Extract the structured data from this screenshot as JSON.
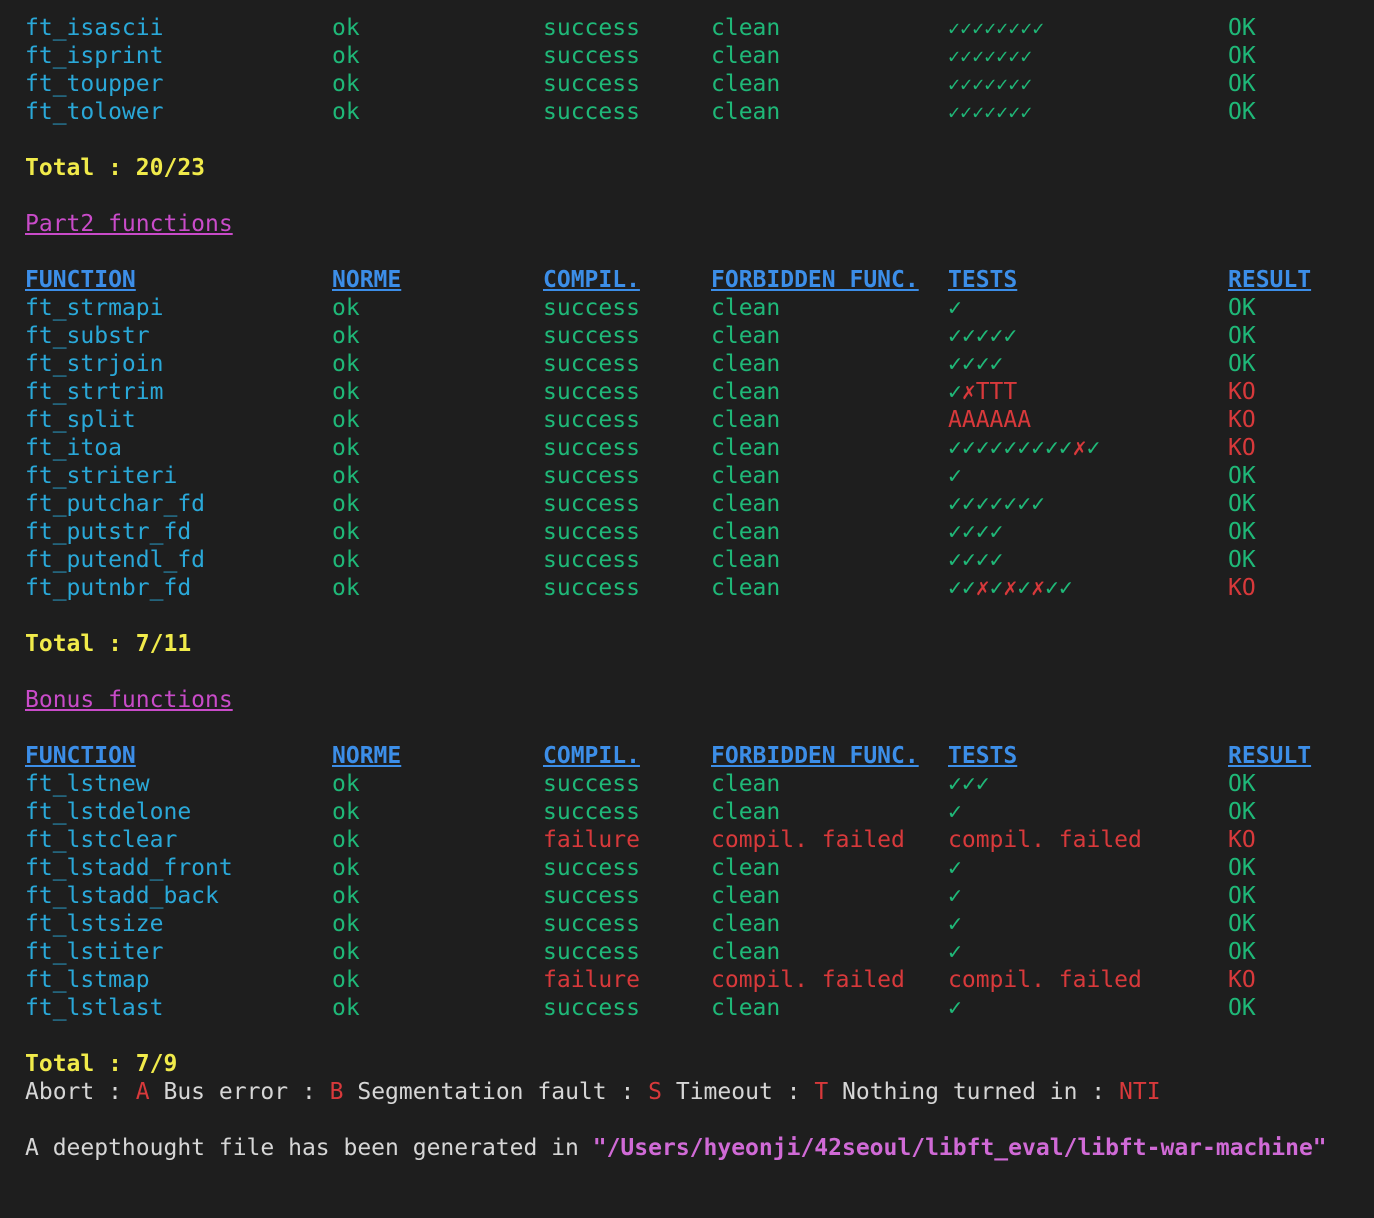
{
  "part1_tail": {
    "rows": [
      {
        "fn": "ft_isascii",
        "norme": "ok",
        "compil": "success",
        "forbidden": "clean",
        "tests": [
          {
            "t": "✓✓✓✓✓✓✓✓",
            "s": "ok"
          }
        ],
        "result": "OK"
      },
      {
        "fn": "ft_isprint",
        "norme": "ok",
        "compil": "success",
        "forbidden": "clean",
        "tests": [
          {
            "t": "✓✓✓✓✓✓✓",
            "s": "ok"
          }
        ],
        "result": "OK"
      },
      {
        "fn": "ft_toupper",
        "norme": "ok",
        "compil": "success",
        "forbidden": "clean",
        "tests": [
          {
            "t": "✓✓✓✓✓✓✓",
            "s": "ok"
          }
        ],
        "result": "OK"
      },
      {
        "fn": "ft_tolower",
        "norme": "ok",
        "compil": "success",
        "forbidden": "clean",
        "tests": [
          {
            "t": "✓✓✓✓✓✓✓",
            "s": "ok"
          }
        ],
        "result": "OK"
      }
    ],
    "total": "Total : 20/23"
  },
  "part2": {
    "title": "Part2 functions",
    "headers": {
      "function": "FUNCTION",
      "norme": "NORME",
      "compil": "COMPIL.",
      "forbidden": "FORBIDDEN FUNC.",
      "tests": "TESTS",
      "result": "RESULT"
    },
    "rows": [
      {
        "fn": "ft_strmapi",
        "norme": "ok",
        "compil": "success",
        "forbidden": "clean",
        "tests": [
          {
            "t": "✓",
            "s": "ok"
          }
        ],
        "result": "OK"
      },
      {
        "fn": "ft_substr",
        "norme": "ok",
        "compil": "success",
        "forbidden": "clean",
        "tests": [
          {
            "t": "✓✓✓✓✓",
            "s": "ok"
          }
        ],
        "result": "OK"
      },
      {
        "fn": "ft_strjoin",
        "norme": "ok",
        "compil": "success",
        "forbidden": "clean",
        "tests": [
          {
            "t": "✓✓✓✓",
            "s": "ok"
          }
        ],
        "result": "OK"
      },
      {
        "fn": "ft_strtrim",
        "norme": "ok",
        "compil": "success",
        "forbidden": "clean",
        "tests": [
          {
            "t": "✓",
            "s": "ok"
          },
          {
            "t": "✗TTT",
            "s": "ko"
          }
        ],
        "result": "KO"
      },
      {
        "fn": "ft_split",
        "norme": "ok",
        "compil": "success",
        "forbidden": "clean",
        "tests": [
          {
            "t": "AAAAAA",
            "s": "ko"
          }
        ],
        "result": "KO"
      },
      {
        "fn": "ft_itoa",
        "norme": "ok",
        "compil": "success",
        "forbidden": "clean",
        "tests": [
          {
            "t": "✓✓✓✓✓✓✓✓✓",
            "s": "ok"
          },
          {
            "t": "✗",
            "s": "ko"
          },
          {
            "t": "✓",
            "s": "ok"
          }
        ],
        "result": "KO"
      },
      {
        "fn": "ft_striteri",
        "norme": "ok",
        "compil": "success",
        "forbidden": "clean",
        "tests": [
          {
            "t": "✓",
            "s": "ok"
          }
        ],
        "result": "OK"
      },
      {
        "fn": "ft_putchar_fd",
        "norme": "ok",
        "compil": "success",
        "forbidden": "clean",
        "tests": [
          {
            "t": "✓✓✓✓✓✓✓",
            "s": "ok"
          }
        ],
        "result": "OK"
      },
      {
        "fn": "ft_putstr_fd",
        "norme": "ok",
        "compil": "success",
        "forbidden": "clean",
        "tests": [
          {
            "t": "✓✓✓✓",
            "s": "ok"
          }
        ],
        "result": "OK"
      },
      {
        "fn": "ft_putendl_fd",
        "norme": "ok",
        "compil": "success",
        "forbidden": "clean",
        "tests": [
          {
            "t": "✓✓✓✓",
            "s": "ok"
          }
        ],
        "result": "OK"
      },
      {
        "fn": "ft_putnbr_fd",
        "norme": "ok",
        "compil": "success",
        "forbidden": "clean",
        "tests": [
          {
            "t": "✓✓",
            "s": "ok"
          },
          {
            "t": "✗",
            "s": "ko"
          },
          {
            "t": "✓",
            "s": "ok"
          },
          {
            "t": "✗",
            "s": "ko"
          },
          {
            "t": "✓",
            "s": "ok"
          },
          {
            "t": "✗",
            "s": "ko"
          },
          {
            "t": "✓✓",
            "s": "ok"
          }
        ],
        "result": "KO"
      }
    ],
    "total": "Total : 7/11"
  },
  "bonus": {
    "title": "Bonus functions",
    "headers": {
      "function": "FUNCTION",
      "norme": "NORME",
      "compil": "COMPIL.",
      "forbidden": "FORBIDDEN FUNC.",
      "tests": "TESTS",
      "result": "RESULT"
    },
    "rows": [
      {
        "fn": "ft_lstnew",
        "norme": "ok",
        "compil": "success",
        "forbidden": "clean",
        "tests": [
          {
            "t": "✓✓✓",
            "s": "ok"
          }
        ],
        "result": "OK"
      },
      {
        "fn": "ft_lstdelone",
        "norme": "ok",
        "compil": "success",
        "forbidden": "clean",
        "tests": [
          {
            "t": "✓",
            "s": "ok"
          }
        ],
        "result": "OK"
      },
      {
        "fn": "ft_lstclear",
        "norme": "ok",
        "compil": "failure",
        "forbidden": "compil. failed",
        "tests": [
          {
            "t": "compil. failed",
            "s": "kotext"
          }
        ],
        "result": "KO"
      },
      {
        "fn": "ft_lstadd_front",
        "norme": "ok",
        "compil": "success",
        "forbidden": "clean",
        "tests": [
          {
            "t": "✓",
            "s": "ok"
          }
        ],
        "result": "OK"
      },
      {
        "fn": "ft_lstadd_back",
        "norme": "ok",
        "compil": "success",
        "forbidden": "clean",
        "tests": [
          {
            "t": "✓",
            "s": "ok"
          }
        ],
        "result": "OK"
      },
      {
        "fn": "ft_lstsize",
        "norme": "ok",
        "compil": "success",
        "forbidden": "clean",
        "tests": [
          {
            "t": "✓",
            "s": "ok"
          }
        ],
        "result": "OK"
      },
      {
        "fn": "ft_lstiter",
        "norme": "ok",
        "compil": "success",
        "forbidden": "clean",
        "tests": [
          {
            "t": "✓",
            "s": "ok"
          }
        ],
        "result": "OK"
      },
      {
        "fn": "ft_lstmap",
        "norme": "ok",
        "compil": "failure",
        "forbidden": "compil. failed",
        "tests": [
          {
            "t": "compil. failed",
            "s": "kotext"
          }
        ],
        "result": "KO"
      },
      {
        "fn": "ft_lstlast",
        "norme": "ok",
        "compil": "success",
        "forbidden": "clean",
        "tests": [
          {
            "t": "✓",
            "s": "ok"
          }
        ],
        "result": "OK"
      }
    ],
    "total": "Total : 7/9"
  },
  "legend": [
    {
      "label": "Abort : ",
      "code": "A"
    },
    {
      "label": " Bus error : ",
      "code": "B"
    },
    {
      "label": " Segmentation fault : ",
      "code": "S"
    },
    {
      "label": " Timeout : ",
      "code": "T"
    },
    {
      "label": " Nothing turned in : ",
      "code": "NTI"
    }
  ],
  "deepthought": {
    "prefix": "A deepthought file has been generated in ",
    "path": "\"/Users/hyeonji/42seoul/libft_eval/libft-war-machine\""
  },
  "colors": {
    "background": "#1e1e1e",
    "function_name": "#2aa8d8",
    "ok_green": "#1fb878",
    "ko_red": "#d8393b",
    "total_yellow": "#f0ea4a",
    "header_blue": "#3c8ee8",
    "section_magenta": "#c94bc9"
  }
}
